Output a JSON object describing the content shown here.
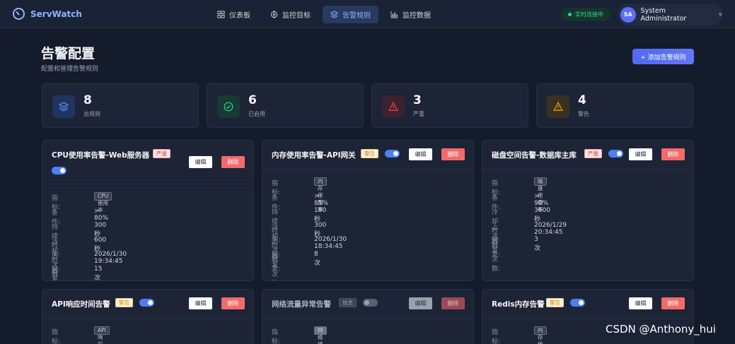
{
  "app": {
    "name": "ServWatch"
  },
  "nav": {
    "tabs": [
      {
        "label": "仪表板",
        "icon": "grid-icon",
        "active": false
      },
      {
        "label": "监控目标",
        "icon": "target-icon",
        "active": false
      },
      {
        "label": "告警规则",
        "icon": "layers-icon",
        "active": true
      },
      {
        "label": "监控数据",
        "icon": "bar-chart-icon",
        "active": false
      }
    ]
  },
  "status": {
    "label": "实时连接中",
    "color": "#34d399"
  },
  "user": {
    "initials": "SA",
    "name": "System Administrator"
  },
  "page": {
    "title": "告警配置",
    "subtitle": "配置和管理告警规则",
    "add_button": "+ 添加告警规则"
  },
  "stats": [
    {
      "value": "8",
      "label": "总规则",
      "icon": "layers-icon",
      "color": "#3b6fd4"
    },
    {
      "value": "6",
      "label": "已启用",
      "icon": "check-circle-icon",
      "color": "#34d399"
    },
    {
      "value": "3",
      "label": "严重",
      "icon": "alert-triangle-icon",
      "color": "#ef4444"
    },
    {
      "value": "4",
      "label": "警告",
      "icon": "alert-triangle-icon",
      "color": "#f59e0b"
    }
  ],
  "labels": {
    "metric": "指标:",
    "condition": "条件:",
    "duration": "持续时间:",
    "cooldown": "冷却时间:",
    "last_triggered": "上次触发:",
    "trigger_count": "触发次数:",
    "edit": "编辑",
    "delete": "删除"
  },
  "rules": [
    {
      "title": "CPU使用率告警-Web服务器",
      "severity": "严重",
      "enabled": true,
      "metric": "CPU使用率",
      "condition": "> 80%",
      "duration": "300 秒",
      "cooldown": "600 秒",
      "last_triggered": "2026/1/30 19:34:45",
      "trigger_count": "15 次"
    },
    {
      "title": "内存使用率告警-API网关",
      "severity": "警告",
      "enabled": true,
      "metric": "内存使用率",
      "condition": "> 85%",
      "duration": "180 秒",
      "cooldown": "300 秒",
      "last_triggered": "2026/1/30 18:34:45",
      "trigger_count": "8 次"
    },
    {
      "title": "磁盘空间告警-数据库主库",
      "severity": "严重",
      "enabled": true,
      "metric": "磁盘使用率",
      "condition": "> 90%",
      "duration": "3600 秒",
      "last_triggered": "2026/1/29 20:34:45",
      "trigger_count": "3 次"
    },
    {
      "title": "API响应时间告警",
      "severity": "警告",
      "enabled": true,
      "metric": "API响应时间"
    },
    {
      "title": "网络流量异常告警",
      "severity": "信息",
      "enabled": false,
      "metric": "网络接收速率"
    },
    {
      "title": "Redis内存告警",
      "severity": "警告",
      "enabled": true,
      "metric": "内存使用率"
    }
  ],
  "watermark": "CSDN @Anthony_hui"
}
